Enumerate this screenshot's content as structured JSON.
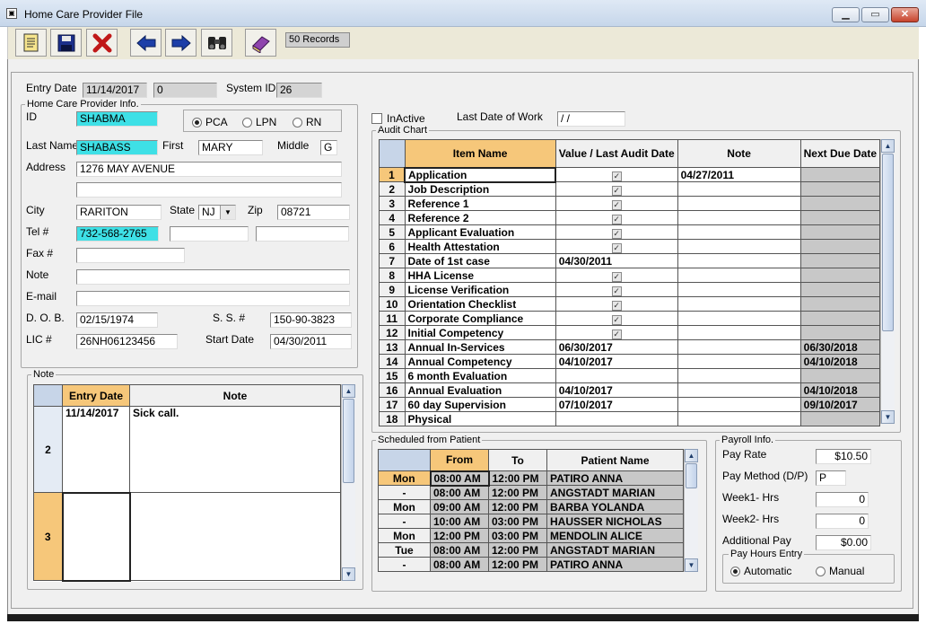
{
  "window": {
    "title": "Home Care Provider File"
  },
  "toolbar": {
    "records": "50 Records"
  },
  "header": {
    "entry_date_label": "Entry Date",
    "entry_date": "11/14/2017",
    "entry_num": "0",
    "system_id_label": "System ID",
    "system_id": "26"
  },
  "provider": {
    "group_title": "Home Care Provider Info.",
    "id_label": "ID",
    "id": "SHABMA",
    "type_options": [
      "PCA",
      "LPN",
      "RN"
    ],
    "type_selected": "PCA",
    "last_name_label": "Last Name",
    "last_name": "SHABASS",
    "first_label": "First",
    "first": "MARY",
    "middle_label": "Middle",
    "middle": "G",
    "address_label": "Address",
    "address1": "1276 MAY AVENUE",
    "address2": "",
    "city_label": "City",
    "city": "RARITON",
    "state_label": "State",
    "state": "NJ",
    "zip_label": "Zip",
    "zip": "08721",
    "tel_label": "Tel #",
    "tel": "732-568-2765",
    "tel2": "",
    "tel3": "",
    "fax_label": "Fax #",
    "fax": "",
    "note_label": "Note",
    "note": "",
    "email_label": "E-mail",
    "email": "",
    "dob_label": "D. O. B.",
    "dob": "02/15/1974",
    "ss_label": "S. S. #",
    "ss": "150-90-3823",
    "lic_label": "LIC #",
    "lic": "26NH06123456",
    "start_label": "Start Date",
    "start": "04/30/2011"
  },
  "status": {
    "inactive_label": "InActive",
    "last_work_label": "Last Date of Work",
    "last_work": " /  /"
  },
  "notes": {
    "group_title": "Note",
    "headers": [
      "Entry Date",
      "Note"
    ],
    "rows": [
      {
        "num": "2",
        "date": "11/14/2017",
        "note": "Sick call."
      },
      {
        "num": "3",
        "date": "",
        "note": ""
      }
    ]
  },
  "audit": {
    "group_title": "Audit Chart",
    "headers": [
      "Item Name",
      "Value / Last Audit Date",
      "Note",
      "Next Due Date"
    ],
    "rows": [
      {
        "num": "1",
        "item": "Application",
        "value": "check",
        "note": "04/27/2011",
        "next": ""
      },
      {
        "num": "2",
        "item": "Job Description",
        "value": "check",
        "note": "",
        "next": ""
      },
      {
        "num": "3",
        "item": "Reference 1",
        "value": "check",
        "note": "",
        "next": ""
      },
      {
        "num": "4",
        "item": "Reference 2",
        "value": "check",
        "note": "",
        "next": ""
      },
      {
        "num": "5",
        "item": "Applicant Evaluation",
        "value": "check",
        "note": "",
        "next": ""
      },
      {
        "num": "6",
        "item": "Health Attestation",
        "value": "check",
        "note": "",
        "next": ""
      },
      {
        "num": "7",
        "item": "Date of 1st case",
        "value": "04/30/2011",
        "note": "",
        "next": ""
      },
      {
        "num": "8",
        "item": "HHA License",
        "value": "check",
        "note": "",
        "next": ""
      },
      {
        "num": "9",
        "item": "License Verification",
        "value": "check",
        "note": "",
        "next": ""
      },
      {
        "num": "10",
        "item": "Orientation Checklist",
        "value": "check",
        "note": "",
        "next": ""
      },
      {
        "num": "11",
        "item": "Corporate Compliance",
        "value": "check",
        "note": "",
        "next": ""
      },
      {
        "num": "12",
        "item": "Initial Competency",
        "value": "check",
        "note": "",
        "next": ""
      },
      {
        "num": "13",
        "item": "Annual In-Services",
        "value": "06/30/2017",
        "note": "",
        "next": "06/30/2018"
      },
      {
        "num": "14",
        "item": "Annual Competency",
        "value": "04/10/2017",
        "note": "",
        "next": "04/10/2018"
      },
      {
        "num": "15",
        "item": "6 month Evaluation",
        "value": "",
        "note": "",
        "next": ""
      },
      {
        "num": "16",
        "item": "Annual Evaluation",
        "value": "04/10/2017",
        "note": "",
        "next": "04/10/2018"
      },
      {
        "num": "17",
        "item": "60 day Supervision",
        "value": "07/10/2017",
        "note": "",
        "next": "09/10/2017"
      },
      {
        "num": "18",
        "item": "Physical",
        "value": "",
        "note": "",
        "next": ""
      }
    ]
  },
  "schedule": {
    "group_title": "Scheduled from Patient",
    "headers": [
      "From",
      "To",
      "Patient Name"
    ],
    "rows": [
      {
        "day": "Mon",
        "from": "08:00 AM",
        "to": "12:00 PM",
        "patient": "PATIRO ANNA"
      },
      {
        "day": "-",
        "from": "08:00 AM",
        "to": "12:00 PM",
        "patient": "ANGSTADT MARIAN"
      },
      {
        "day": "Mon",
        "from": "09:00 AM",
        "to": "12:00 PM",
        "patient": "BARBA YOLANDA"
      },
      {
        "day": "-",
        "from": "10:00 AM",
        "to": "03:00 PM",
        "patient": "HAUSSER NICHOLAS"
      },
      {
        "day": "Mon",
        "from": "12:00 PM",
        "to": "03:00 PM",
        "patient": "MENDOLIN ALICE"
      },
      {
        "day": "Tue",
        "from": "08:00 AM",
        "to": "12:00 PM",
        "patient": "ANGSTADT MARIAN"
      },
      {
        "day": "-",
        "from": "08:00 AM",
        "to": "12:00 PM",
        "patient": "PATIRO ANNA"
      }
    ]
  },
  "payroll": {
    "group_title": "Payroll Info.",
    "pay_rate_label": "Pay Rate",
    "pay_rate": "$10.50",
    "pay_method_label": "Pay Method (D/P)",
    "pay_method": "P",
    "week1_label": "Week1- Hrs",
    "week1": "0",
    "week2_label": "Week2- Hrs",
    "week2": "0",
    "additional_label": "Additional Pay",
    "additional": "$0.00",
    "hours_group_title": "Pay Hours Entry",
    "hours_options": [
      "Automatic",
      "Manual"
    ],
    "hours_selected": "Automatic"
  },
  "colors": {
    "highlight": "#3ee0e6",
    "header_selected": "#f6c77a",
    "readonly": "#c8c8c8"
  }
}
